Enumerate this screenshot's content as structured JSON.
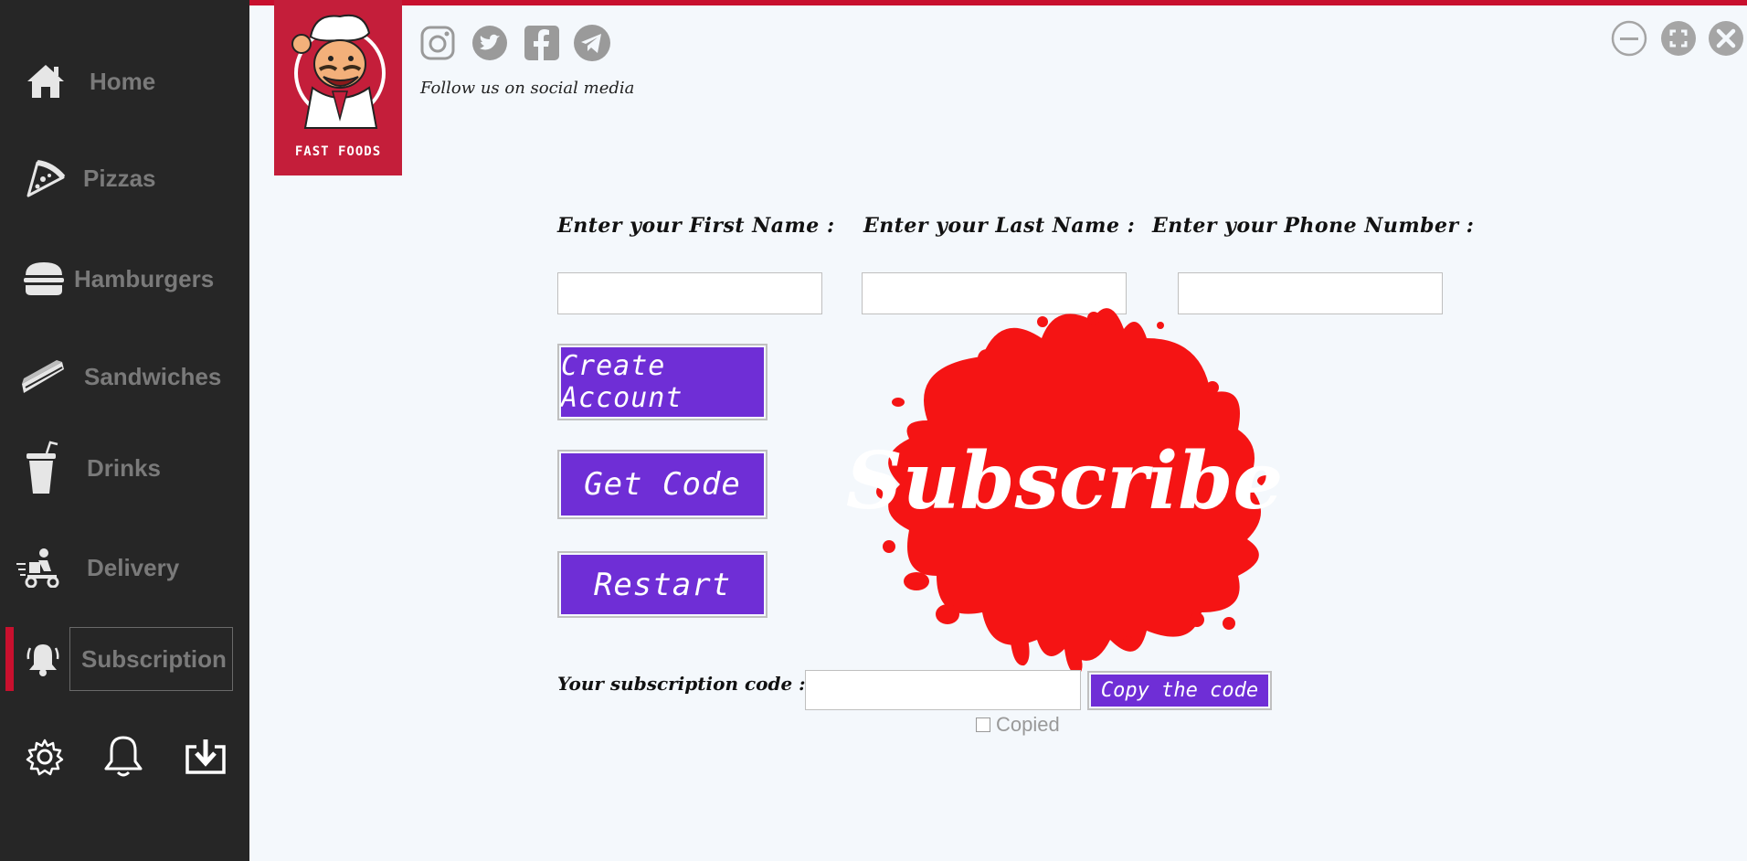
{
  "sidebar": {
    "items": [
      {
        "label": "Home",
        "icon": "home-icon"
      },
      {
        "label": "Pizzas",
        "icon": "pizza-icon"
      },
      {
        "label": "Hamburgers",
        "icon": "hamburger-icon"
      },
      {
        "label": "Sandwiches",
        "icon": "sandwich-icon"
      },
      {
        "label": "Drinks",
        "icon": "drink-icon"
      },
      {
        "label": "Delivery",
        "icon": "delivery-icon"
      },
      {
        "label": "Subscription",
        "icon": "subscription-bell-icon",
        "active": true
      }
    ],
    "bottom_icons": [
      "settings-icon",
      "notification-bell-icon",
      "download-icon"
    ]
  },
  "header": {
    "logo_text": "FAST FOODS",
    "social_icons": [
      "instagram-icon",
      "twitter-icon",
      "facebook-icon",
      "telegram-icon"
    ],
    "follow_text": "Follow us on social media",
    "window_controls": [
      "minimize-icon",
      "maximize-icon",
      "close-icon"
    ]
  },
  "form": {
    "first_name_label": "Enter your First Name :",
    "last_name_label": "Enter your Last Name :",
    "phone_label": "Enter your Phone Number :",
    "first_name_value": "",
    "last_name_value": "",
    "phone_value": ""
  },
  "buttons": {
    "create_account": "Create Account",
    "get_code": "Get Code",
    "restart": "Restart",
    "copy_code": "Copy the code"
  },
  "subscribe_text": "Subscribe",
  "code": {
    "label": "Your subscription code :",
    "value": "",
    "copied_label": "Copied",
    "copied_checked": false
  },
  "colors": {
    "accent": "#c8102e",
    "button": "#6f2ed6",
    "sidebar_bg": "#262626",
    "splat": "#f51414",
    "background": "#f4f8fc"
  }
}
